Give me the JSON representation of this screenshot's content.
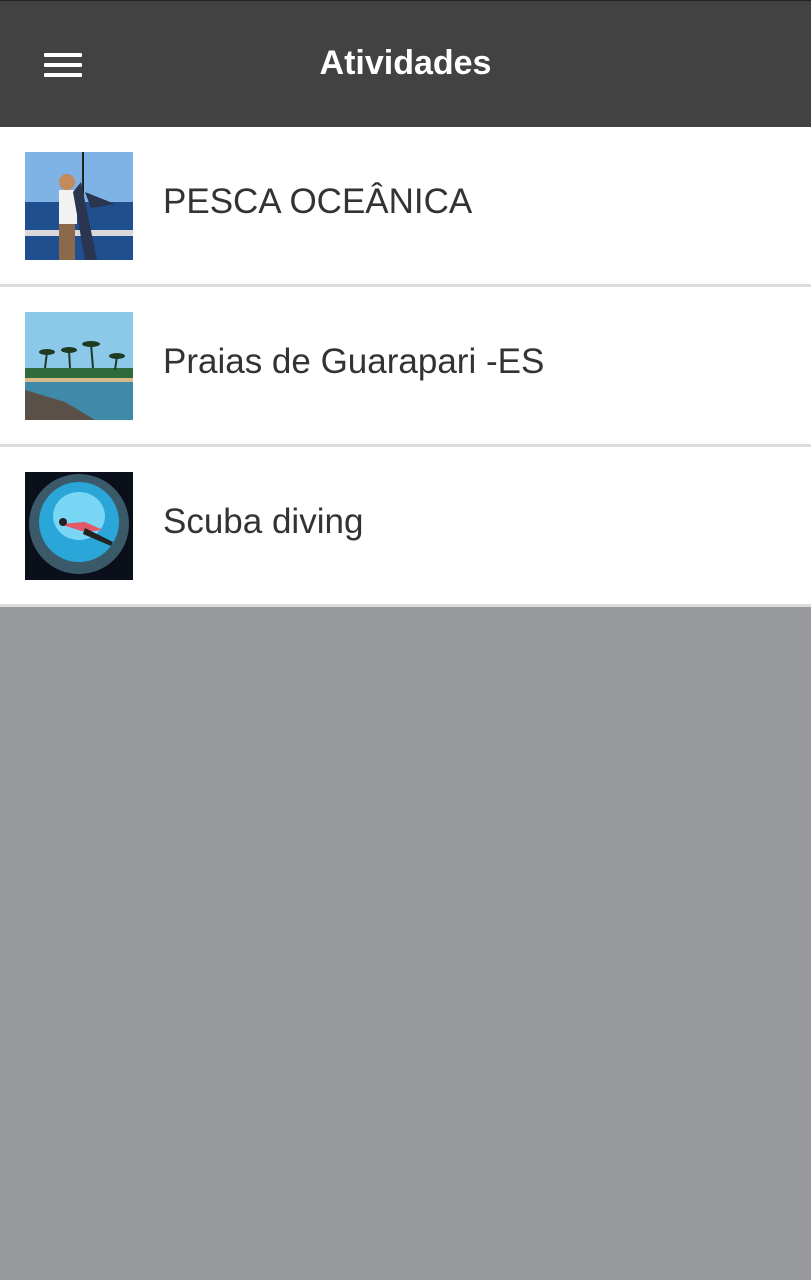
{
  "header": {
    "title": "Atividades",
    "menu_icon": "hamburger-menu-icon"
  },
  "activities": [
    {
      "label": "PESCA OCEÂNICA",
      "thumbnail": "fishing-photo"
    },
    {
      "label": "Praias de Guarapari -ES",
      "thumbnail": "beach-photo"
    },
    {
      "label": "Scuba diving",
      "thumbnail": "diving-photo"
    }
  ],
  "colors": {
    "header_bg": "#424242",
    "list_bg": "#ffffff",
    "divider": "#dcdcdc",
    "background": "#98999d",
    "text": "#333333"
  }
}
